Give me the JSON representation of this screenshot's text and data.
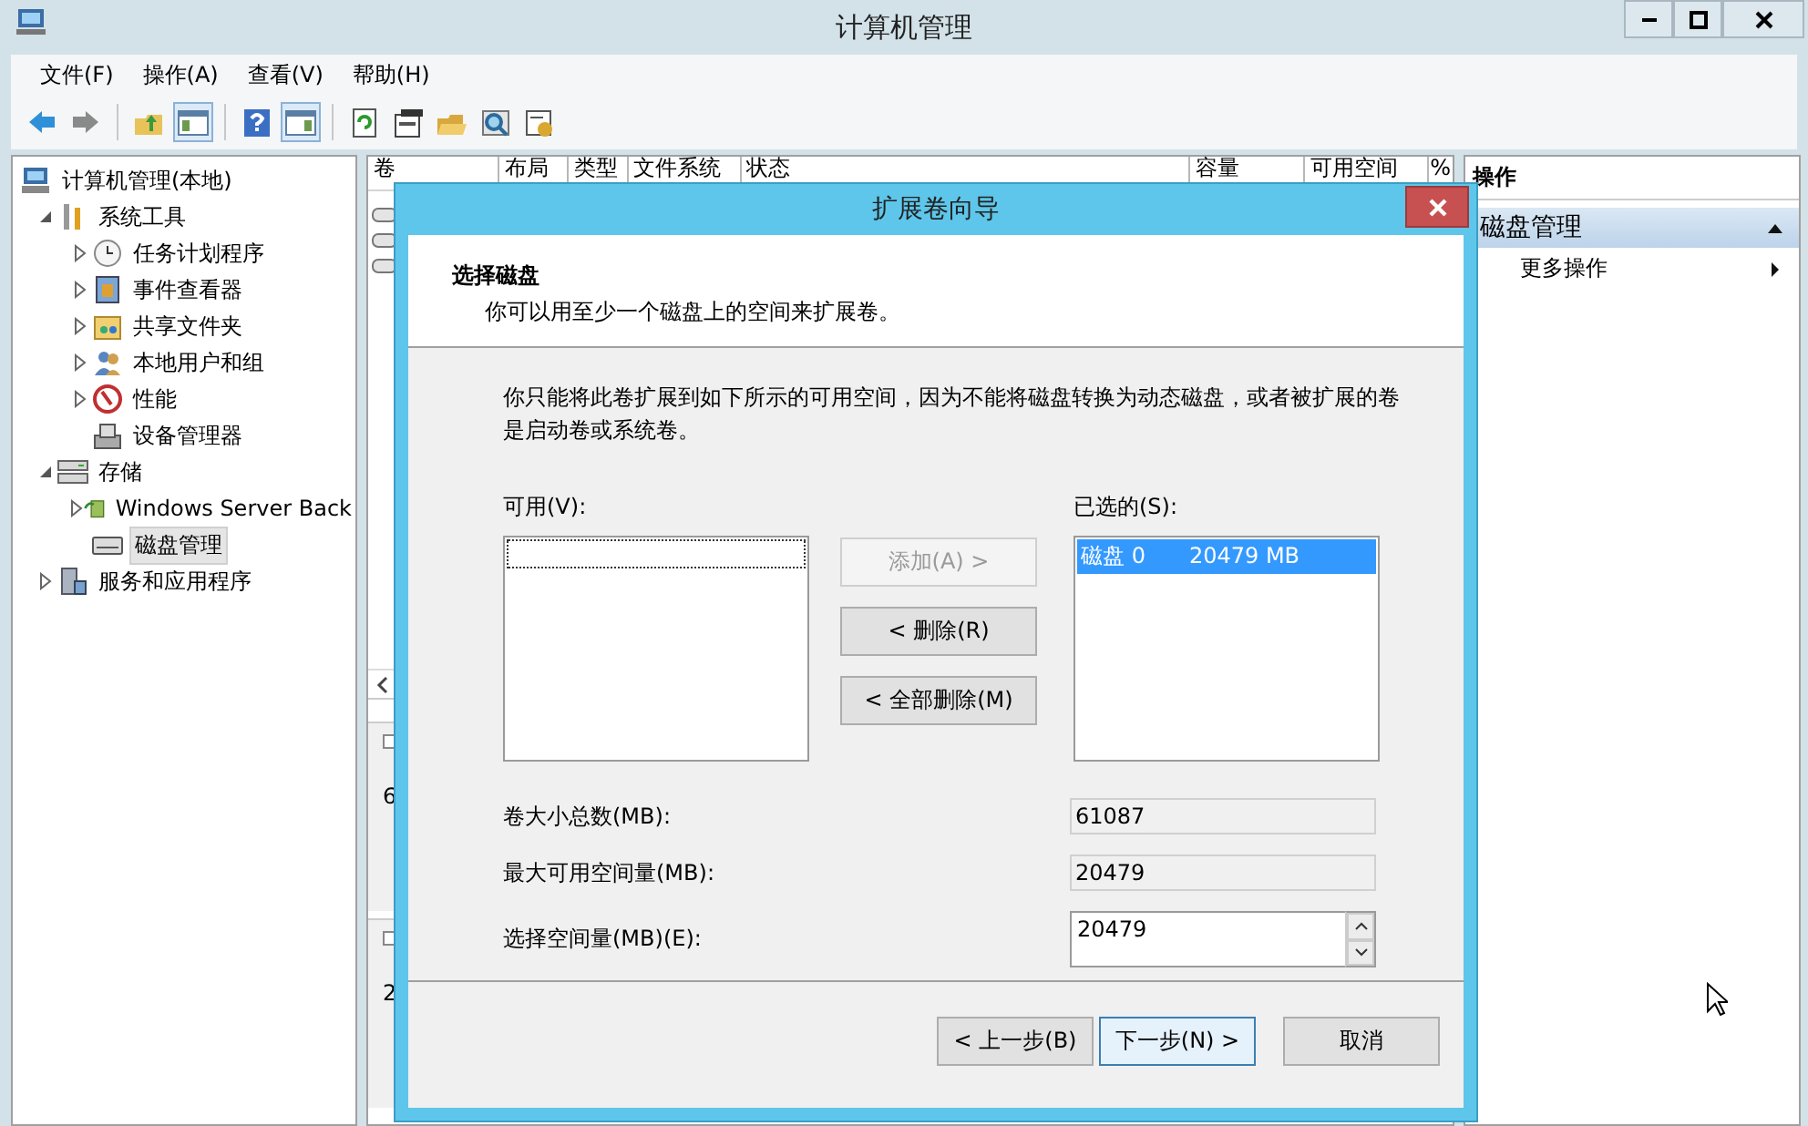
{
  "window": {
    "title": "计算机管理"
  },
  "menu": [
    {
      "label": "文件(F)"
    },
    {
      "label": "操作(A)"
    },
    {
      "label": "查看(V)"
    },
    {
      "label": "帮助(H)"
    }
  ],
  "toolbar": [
    {
      "kind": "back",
      "pressed": false
    },
    {
      "kind": "forward",
      "pressed": false
    },
    {
      "kind": "sep"
    },
    {
      "kind": "up",
      "pressed": false
    },
    {
      "kind": "pane",
      "pressed": true
    },
    {
      "kind": "sep"
    },
    {
      "kind": "help",
      "pressed": false
    },
    {
      "kind": "pane2",
      "pressed": true
    },
    {
      "kind": "sep"
    },
    {
      "kind": "refresh",
      "pressed": false
    },
    {
      "kind": "props",
      "pressed": false
    },
    {
      "kind": "open",
      "pressed": false
    },
    {
      "kind": "find",
      "pressed": false
    },
    {
      "kind": "config",
      "pressed": false
    }
  ],
  "tree": [
    {
      "label": "计算机管理(本地)",
      "kind": "computer",
      "selected": false,
      "children": [
        {
          "label": "系统工具",
          "kind": "tools",
          "expanded": true,
          "selected": false,
          "children": [
            {
              "label": "任务计划程序",
              "kind": "clock",
              "expanded": false,
              "selected": false
            },
            {
              "label": "事件查看器",
              "kind": "event",
              "expanded": false,
              "selected": false
            },
            {
              "label": "共享文件夹",
              "kind": "share",
              "expanded": false,
              "selected": false
            },
            {
              "label": "本地用户和组",
              "kind": "users",
              "expanded": false,
              "selected": false
            },
            {
              "label": "性能",
              "kind": "perf",
              "expanded": false,
              "selected": false
            },
            {
              "label": "设备管理器",
              "kind": "device",
              "selected": false
            }
          ]
        },
        {
          "label": "存储",
          "kind": "storage",
          "expanded": true,
          "selected": false,
          "children": [
            {
              "label": "Windows Server Back",
              "kind": "backup",
              "expanded": false,
              "selected": false
            },
            {
              "label": "磁盘管理",
              "kind": "disk",
              "selected": true
            }
          ]
        },
        {
          "label": "服务和应用程序",
          "kind": "services",
          "expanded": false,
          "selected": false
        }
      ]
    }
  ],
  "volume_table": {
    "columns": [
      "卷",
      "布局",
      "类型",
      "文件系统",
      "状态",
      "容量",
      "可用空间",
      "%"
    ]
  },
  "disk_map": [
    {
      "lines": [
        "6"
      ]
    },
    {
      "lines": [
        "2"
      ]
    }
  ],
  "actions": {
    "title": "操作",
    "section": "磁盘管理",
    "expanded": true,
    "items": [
      {
        "label": "更多操作"
      }
    ]
  },
  "dialog": {
    "title": "扩展卷向导",
    "heading": "选择磁盘",
    "subheading": "你可以用至少一个磁盘上的空间来扩展卷。",
    "note": "你只能将此卷扩展到如下所示的可用空间，因为不能将磁盘转换为动态磁盘，或者被扩展的卷是启动卷或系统卷。",
    "available": {
      "label": "可用(V):"
    },
    "chosen": {
      "label": "已选的(S):",
      "items": [
        {
          "disk": "磁盘 0",
          "size": "20479 MB",
          "selected": true
        }
      ]
    },
    "move_buttons": [
      {
        "label": "添加(A) >",
        "disabled": true
      },
      {
        "label": "< 删除(R)",
        "disabled": false
      },
      {
        "label": "< 全部删除(M)",
        "disabled": false
      }
    ],
    "fields": [
      {
        "label": "卷大小总数(MB):",
        "value": "61087",
        "kind": "readonly"
      },
      {
        "label": "最大可用空间量(MB):",
        "value": "20479",
        "kind": "readonly"
      },
      {
        "label": "选择空间量(MB)(E):",
        "value": "20479",
        "kind": "spinner"
      }
    ],
    "buttons": [
      {
        "label": "< 上一步(B)",
        "default": false
      },
      {
        "label": "下一步(N) >",
        "default": true
      },
      {
        "label": "取消",
        "default": false
      }
    ]
  }
}
